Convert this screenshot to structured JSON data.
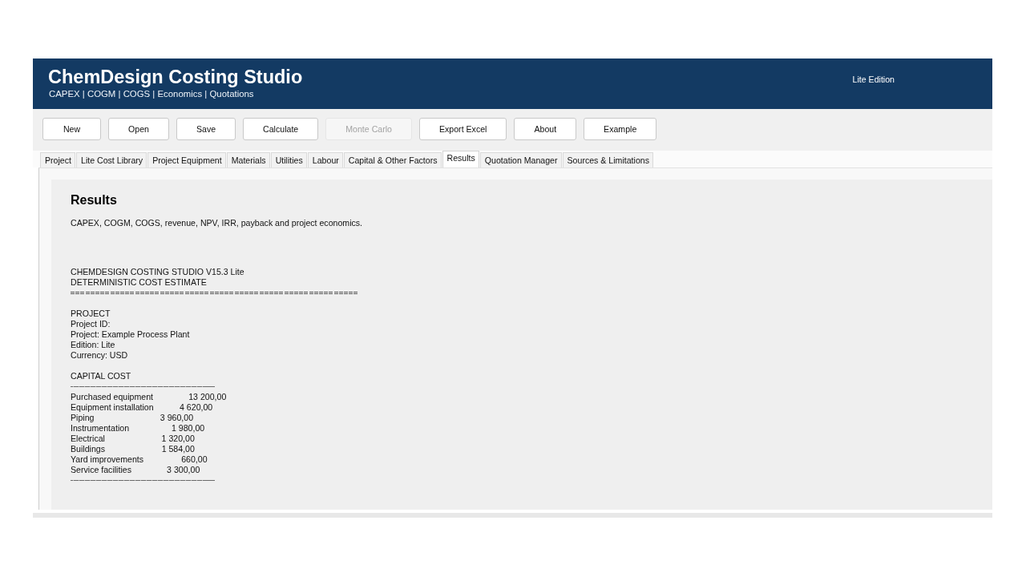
{
  "header": {
    "title": "ChemDesign Costing Studio",
    "subtitle": "CAPEX | COGM | COGS | Economics | Quotations",
    "edition": "Lite Edition"
  },
  "toolbar": {
    "buttons": [
      {
        "label": "New",
        "disabled": false
      },
      {
        "label": "Open",
        "disabled": false
      },
      {
        "label": "Save",
        "disabled": false
      },
      {
        "label": "Calculate",
        "disabled": false
      },
      {
        "label": "Monte Carlo",
        "disabled": true
      },
      {
        "label": "Export Excel",
        "disabled": false
      },
      {
        "label": "About",
        "disabled": false
      },
      {
        "label": "Example",
        "disabled": false
      }
    ]
  },
  "tabs": [
    {
      "label": "Project",
      "selected": false
    },
    {
      "label": "Lite Cost Library",
      "selected": false
    },
    {
      "label": "Project Equipment",
      "selected": false
    },
    {
      "label": "Materials",
      "selected": false
    },
    {
      "label": "Utilities",
      "selected": false
    },
    {
      "label": "Labour",
      "selected": false
    },
    {
      "label": "Capital & Other Factors",
      "selected": false
    },
    {
      "label": "Results",
      "selected": true
    },
    {
      "label": "Quotation Manager",
      "selected": false
    },
    {
      "label": "Sources & Limitations",
      "selected": false
    }
  ],
  "results_page": {
    "heading": "Results",
    "description": "CAPEX, COGM, COGS, revenue, NPV, IRR, payback and project economics.",
    "report": [
      {
        "lines": [
          {
            "kind": "text",
            "text": "CHEMDESIGN COSTING STUDIO V15.3 Lite"
          },
          {
            "kind": "text",
            "text": "DETERMINISTIC COST ESTIMATE"
          },
          {
            "kind": "equals"
          }
        ]
      },
      {
        "lines": [
          {
            "kind": "text",
            "text": "PROJECT"
          },
          {
            "kind": "text",
            "text": "Project ID:"
          },
          {
            "kind": "text",
            "text": "Project: Example Process Plant"
          },
          {
            "kind": "text",
            "text": "Edition: Lite"
          },
          {
            "kind": "text",
            "text": "Currency: USD"
          }
        ]
      },
      {
        "lines": [
          {
            "kind": "text",
            "text": "CAPITAL COST"
          },
          {
            "kind": "dashes"
          },
          {
            "kind": "text",
            "text": "Purchased equipment               13 200,00"
          },
          {
            "kind": "text",
            "text": "Equipment installation           4 620,00"
          },
          {
            "kind": "text",
            "text": "Piping                            3 960,00"
          },
          {
            "kind": "text",
            "text": "Instrumentation                  1 980,00"
          },
          {
            "kind": "text",
            "text": "Electrical                        1 320,00"
          },
          {
            "kind": "text",
            "text": "Buildings                        1 584,00"
          },
          {
            "kind": "text",
            "text": "Yard improvements                660,00"
          },
          {
            "kind": "text",
            "text": "Service facilities               3 300,00"
          },
          {
            "kind": "dashes"
          }
        ]
      }
    ]
  }
}
